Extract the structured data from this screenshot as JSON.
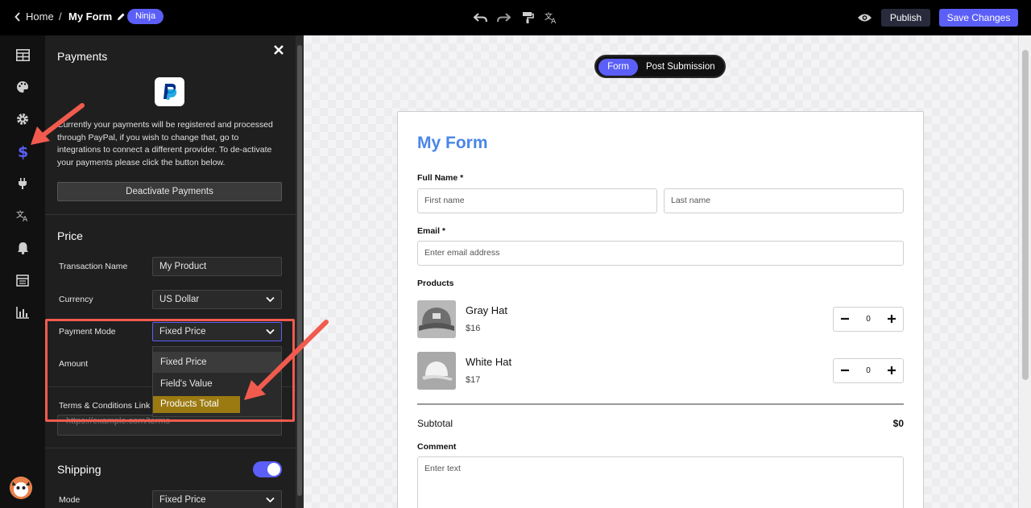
{
  "topbar": {
    "home_label": "Home",
    "separator": "/",
    "form_name": "My Form",
    "badge": "Ninja",
    "publish_label": "Publish",
    "save_label": "Save Changes",
    "icons": [
      "undo-icon",
      "redo-icon",
      "paint-roller-icon",
      "translate-icon",
      "eye-icon"
    ]
  },
  "rail": {
    "items": [
      "layout-icon",
      "palette-icon",
      "gear-icon",
      "dollar-icon",
      "plug-icon",
      "translate-icon",
      "bell-icon",
      "calendar-icon",
      "bar-chart-icon"
    ],
    "active": "dollar-icon",
    "accent": "#5b5ff8"
  },
  "panel": {
    "title": "Payments",
    "description": "Currently your payments will be registered and processed through PayPal, if you wish to change that, go to integrations to connect a different provider. To de-activate your payments please click the button below.",
    "deactivate_label": "Deactivate Payments",
    "price": {
      "title": "Price",
      "transaction_name_label": "Transaction Name",
      "transaction_name_value": "My Product",
      "currency_label": "Currency",
      "currency_value": "US Dollar",
      "payment_mode_label": "Payment Mode",
      "payment_mode_value": "Fixed Price",
      "amount_label": "Amount",
      "terms_label": "Terms & Conditions Link",
      "terms_placeholder": "https://example.com/terms"
    },
    "dropdown": {
      "options": [
        "Fixed Price",
        "Field's Value",
        "Products Total"
      ],
      "highlighted": "Products Total"
    },
    "shipping": {
      "title": "Shipping",
      "enabled": true,
      "mode_label": "Mode",
      "mode_value": "Fixed Price"
    }
  },
  "canvas": {
    "tabs": {
      "form": "Form",
      "post": "Post Submission"
    },
    "form": {
      "title": "My Form",
      "full_name_label": "Full Name *",
      "first_placeholder": "First name",
      "last_placeholder": "Last name",
      "email_label": "Email *",
      "email_placeholder": "Enter email address",
      "products_label": "Products",
      "products": [
        {
          "name": "Gray Hat",
          "price": "$16",
          "qty": "0"
        },
        {
          "name": "White Hat",
          "price": "$17",
          "qty": "0"
        }
      ],
      "subtotal_label": "Subtotal",
      "subtotal_value": "$0",
      "comment_label": "Comment",
      "comment_placeholder": "Enter text"
    }
  },
  "colors": {
    "accent": "#5b5ff8",
    "annotation": "#f15b4e",
    "form_title": "#4a86e8",
    "highlight": "#9b7a11"
  }
}
